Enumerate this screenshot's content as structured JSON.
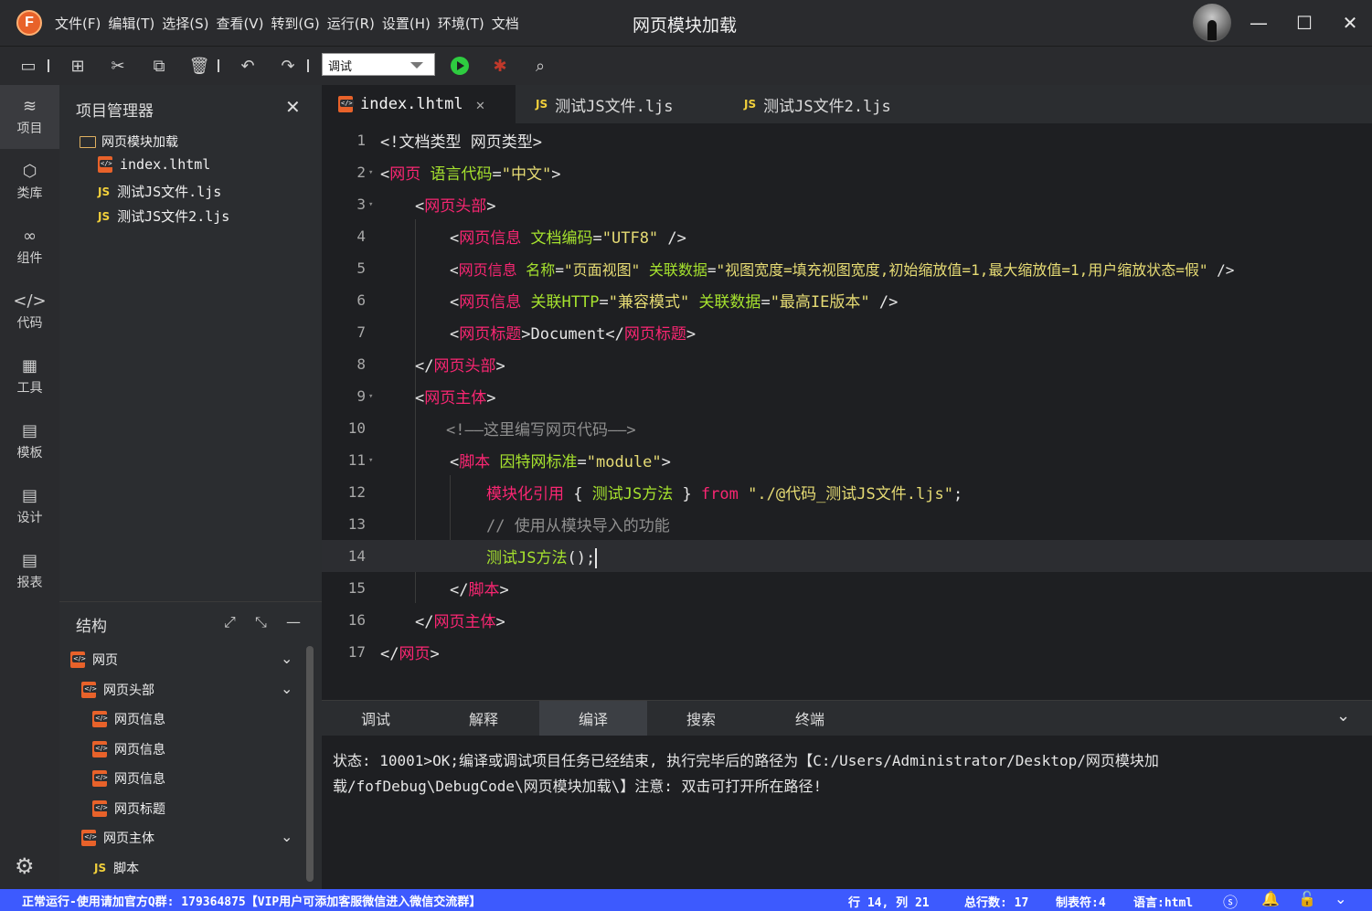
{
  "app": {
    "logo_letter": "F",
    "menus": [
      "文件(F)",
      "编辑(T)",
      "选择(S)",
      "查看(V)",
      "转到(G)",
      "运行(R)",
      "设置(H)",
      "环境(T)",
      "文档"
    ],
    "window_title": "网页模块加载"
  },
  "toolbar": {
    "mode_value": "调试"
  },
  "activity": [
    {
      "label": "项目",
      "icon": "layers-icon"
    },
    {
      "label": "类库",
      "icon": "cube-icon"
    },
    {
      "label": "组件",
      "icon": "link-icon"
    },
    {
      "label": "代码",
      "icon": "code-icon"
    },
    {
      "label": "工具",
      "icon": "tools-icon"
    },
    {
      "label": "模板",
      "icon": "template-icon"
    },
    {
      "label": "设计",
      "icon": "design-icon"
    },
    {
      "label": "报表",
      "icon": "report-icon"
    }
  ],
  "project": {
    "title": "项目管理器",
    "root": "网页模块加载",
    "files": [
      "index.lhtml",
      "测试JS文件.ljs",
      "测试JS文件2.ljs"
    ]
  },
  "structure": {
    "title": "结构",
    "nodes": [
      "网页",
      "网页头部",
      "网页信息",
      "网页信息",
      "网页信息",
      "网页标题",
      "网页主体",
      "脚本"
    ]
  },
  "editor": {
    "tabs": [
      "index.lhtml",
      "测试JS文件.ljs",
      "测试JS文件2.ljs"
    ],
    "line_numbers": [
      "1",
      "2",
      "3",
      "4",
      "5",
      "6",
      "7",
      "8",
      "9",
      "10",
      "11",
      "12",
      "13",
      "14",
      "15",
      "16",
      "17"
    ],
    "current_line": 14
  },
  "output": {
    "tabs": [
      "调试",
      "解释",
      "编译",
      "搜索",
      "终端"
    ],
    "active_tab": "编译",
    "text": "状态: 10001>OK;编译或调试项目任务已经结束, 执行完毕后的路径为【C:/Users/Administrator/Desktop/网页模块加载/fofDebug\\DebugCode\\网页模块加载\\】注意: 双击可打开所在路径!"
  },
  "status": {
    "left": "正常运行-使用请加官方Q群: 179364875【VIP用户可添加客服微信进入微信交流群】",
    "position": "行 14, 列 21",
    "total": "总行数: 17",
    "tab": "制表符:4",
    "language": "语言:html"
  },
  "colors": {
    "accent": "#3d5afe",
    "tag": "#f92672",
    "attr": "#a6e22e",
    "string": "#e6db74",
    "brand": "#e8622a"
  }
}
